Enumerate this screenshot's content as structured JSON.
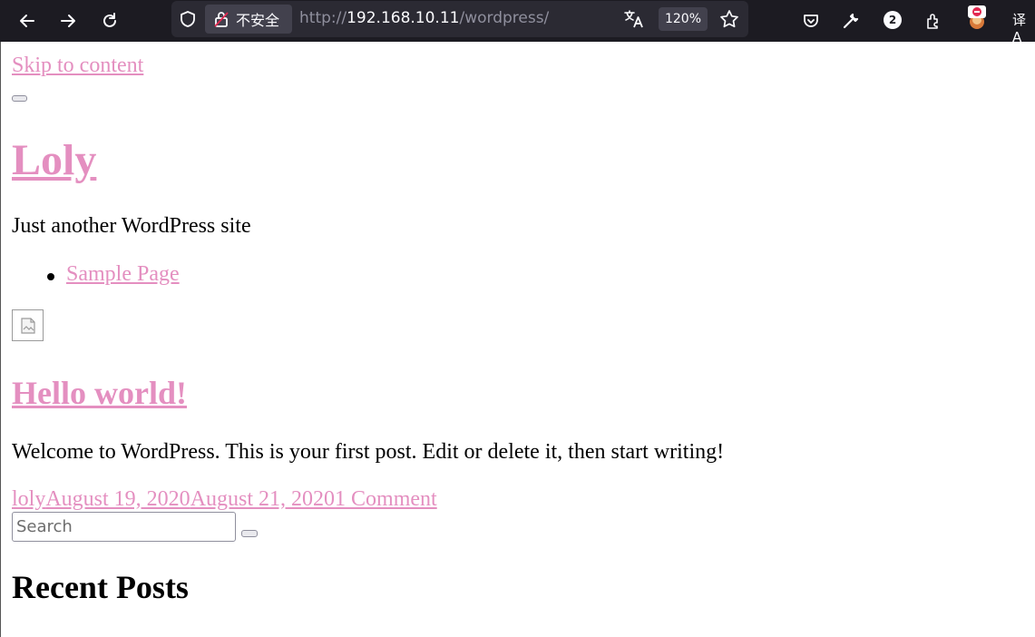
{
  "browser": {
    "url_scheme": "http://",
    "url_host": "192.168.10.11",
    "url_path": "/wordpress/",
    "security_label": "不安全",
    "zoom": "120%",
    "extension_badge_count": "2",
    "lang_label": "译A",
    "icons": [
      "back-icon",
      "forward-icon",
      "reload-icon",
      "shield-icon",
      "insecure-lock-icon",
      "translate-icon",
      "bookmark-star-icon",
      "pocket-icon",
      "wrench-icon",
      "extensions-icon",
      "avatar-icon"
    ]
  },
  "page": {
    "skip_link": "Skip to content",
    "site_title": "Loly",
    "tagline": "Just another WordPress site",
    "nav_items": [
      {
        "label": "Sample Page"
      }
    ],
    "post": {
      "title": "Hello world!",
      "excerpt": "Welcome to WordPress. This is your first post. Edit or delete it, then start writing!",
      "author": "loly",
      "posted_date": "August 19, 2020",
      "updated_date": "August 21, 2020",
      "comments": "1 Comment"
    },
    "search": {
      "placeholder": "Search",
      "value": ""
    },
    "recent_posts_heading": "Recent Posts"
  },
  "colors": {
    "link": "#e48fc0",
    "toolbar_bg": "#1c1b22",
    "urlbar_bg": "#2b2a33"
  }
}
